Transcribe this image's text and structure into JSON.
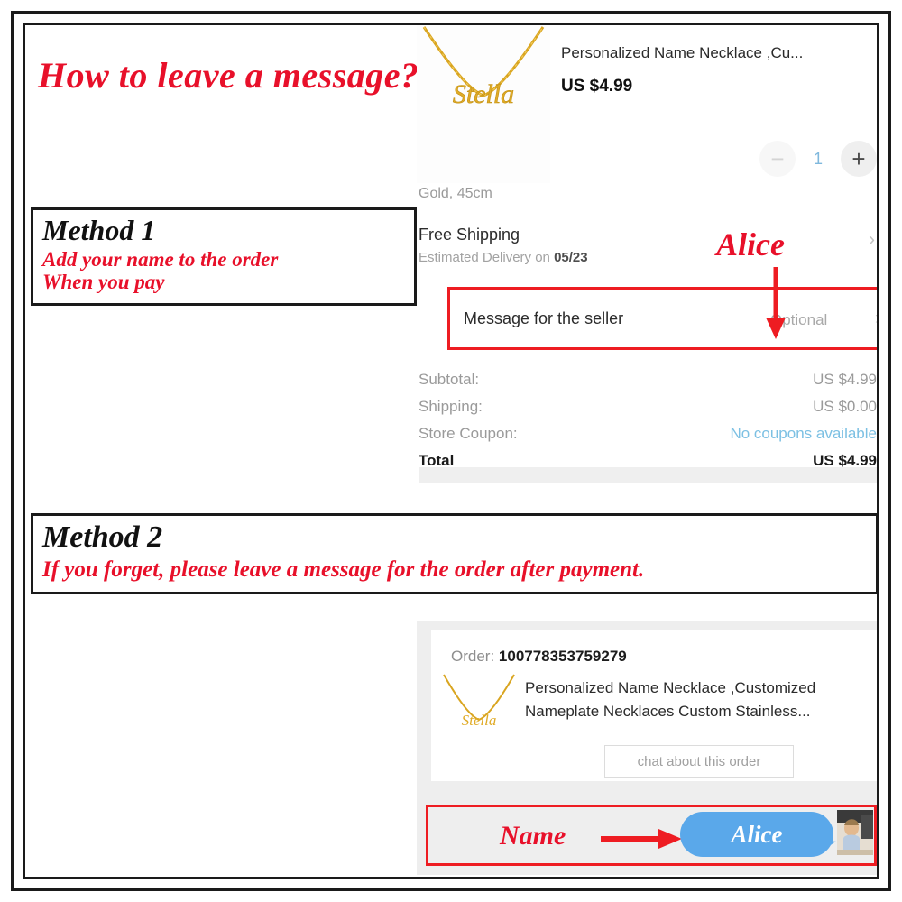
{
  "headline": "How to leave a message?",
  "methods": [
    {
      "title": "Method 1",
      "line1": "Add your name to the order",
      "line2": "When you pay"
    },
    {
      "title": "Method 2",
      "line1": "If you forget, please leave a message for the order after payment."
    }
  ],
  "annotations": {
    "alice": "Alice",
    "name": "Name"
  },
  "checkout": {
    "product_title": "Personalized Name Necklace ,Cu...",
    "price": "US $4.99",
    "quantity": "1",
    "minus_label": "−",
    "plus_label": "+",
    "variant": "Gold, 45cm",
    "shipping_title": "Free Shipping",
    "shipping_sub_prefix": "Estimated Delivery on ",
    "shipping_sub_date": "05/23",
    "message_label": "Message for the seller",
    "message_placeholder": "Optional",
    "chevron": "›",
    "totals": [
      {
        "label": "Subtotal:",
        "value": "US $4.99",
        "style": "normal"
      },
      {
        "label": "Shipping:",
        "value": "US $0.00",
        "style": "normal"
      },
      {
        "label": "Store Coupon:",
        "value": "No coupons available",
        "style": "coupon"
      },
      {
        "label": "Total",
        "value": "US $4.99",
        "style": "grand"
      }
    ]
  },
  "order": {
    "order_label": "Order: ",
    "order_number": "100778353759279",
    "product_title": "Personalized Name Necklace ,Customized Nameplate Necklaces Custom Stainless...",
    "chat_button": "chat about this order",
    "bubble_text": "Alice"
  },
  "colors": {
    "annotation_red": "#e8102a",
    "highlight_red": "#ee1c22",
    "bubble_blue": "#5aa8ea",
    "coupon_blue": "#7cc0e3",
    "qty_blue": "#7fb8dd",
    "panel_gray": "#eeeeee"
  },
  "icons": {
    "necklace": "necklace-image",
    "avatar": "buyer-avatar-image"
  }
}
